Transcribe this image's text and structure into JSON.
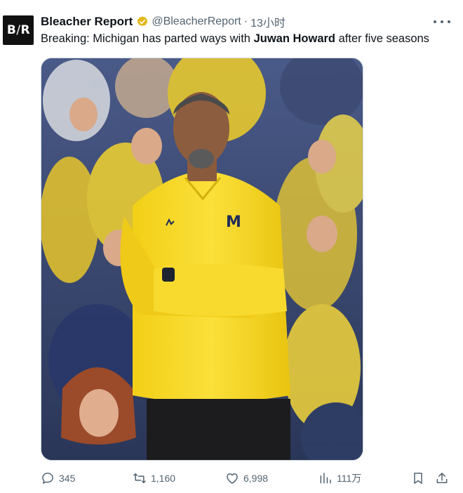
{
  "tweet": {
    "avatar_text_left": "B",
    "avatar_text_slash": "/",
    "avatar_text_right": "R",
    "author_name": "Bleacher Report",
    "handle": "@BleacherReport",
    "separator": "·",
    "timestamp": "13小时",
    "text_before": "Breaking: Michigan has parted ways with ",
    "text_bold": "Juwan Howard",
    "text_after": " after five seasons",
    "media_logo": "M",
    "colors": {
      "text": "#0f1419",
      "secondary": "#536471",
      "verified": "#e2b719",
      "michigan_maize": "#f6d320",
      "michigan_blue": "#1f2d5a"
    }
  },
  "actions": {
    "reply_count": "345",
    "retweet_count": "1,160",
    "like_count": "6,998",
    "views_count": "111万"
  }
}
